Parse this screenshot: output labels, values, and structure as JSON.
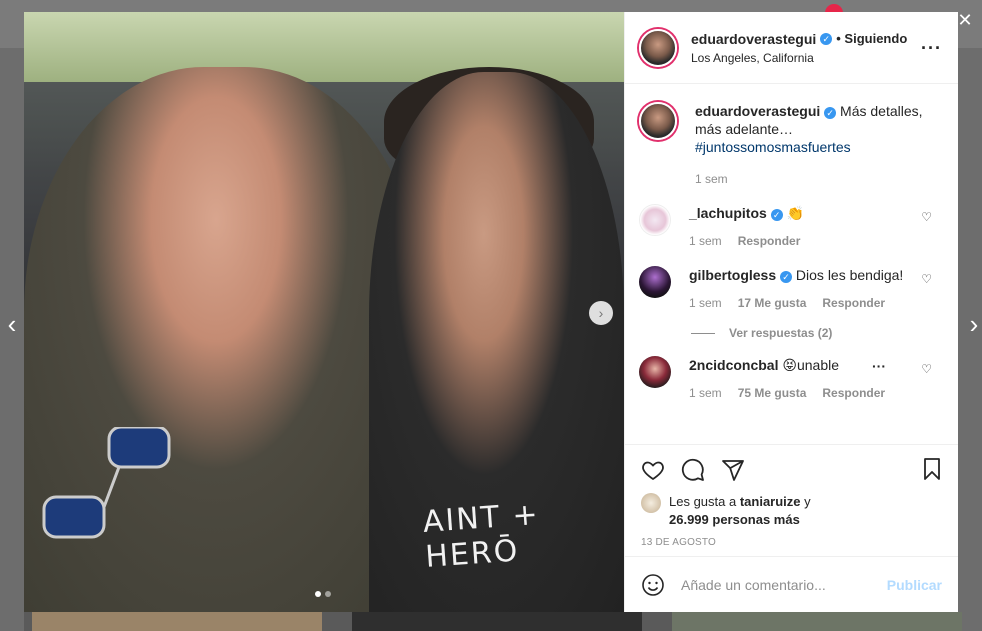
{
  "post": {
    "username": "eduardoverastegui",
    "follow_status": "• Siguiendo",
    "location": "Los Angeles, California",
    "caption_text": "Más detalles, más adelante…",
    "hashtag": "#juntossomosmasfuertes",
    "caption_time": "1 sem",
    "shirt_text": "AINT + HERŌ",
    "image_page": 1,
    "image_count": 2
  },
  "comments": [
    {
      "user": "_lachupitos",
      "verified": true,
      "text": "👏",
      "time": "1 sem",
      "likes": "",
      "reply_label": "Responder"
    },
    {
      "user": "gilbertogless",
      "verified": true,
      "text": "Dios les bendiga!",
      "time": "1 sem",
      "likes": "17 Me gusta",
      "reply_label": "Responder",
      "view_replies": "Ver respuestas (2)"
    },
    {
      "user": "2ncidconcbal",
      "verified": false,
      "text": "😝unable",
      "time": "1 sem",
      "likes": "75 Me gusta",
      "reply_label": "Responder"
    }
  ],
  "likes": {
    "prefix": "Les gusta a",
    "user": "taniaruize",
    "connector": "y",
    "count_text": "26.999 personas más"
  },
  "date": "13 DE AGOSTO",
  "add_comment": {
    "placeholder": "Añade un comentario...",
    "publish_label": "Publicar"
  },
  "icons": {
    "like": "heart-icon",
    "comment": "comment-icon",
    "share": "paper-plane-icon",
    "save": "bookmark-icon",
    "emoji": "smiley-icon",
    "more": "more-options-icon",
    "verified": "verified-badge-icon"
  },
  "colors": {
    "verified": "#3897f0",
    "hashtag": "#00376b",
    "publish_disabled": "#b3dbff",
    "story_ring": "#e1306c"
  }
}
